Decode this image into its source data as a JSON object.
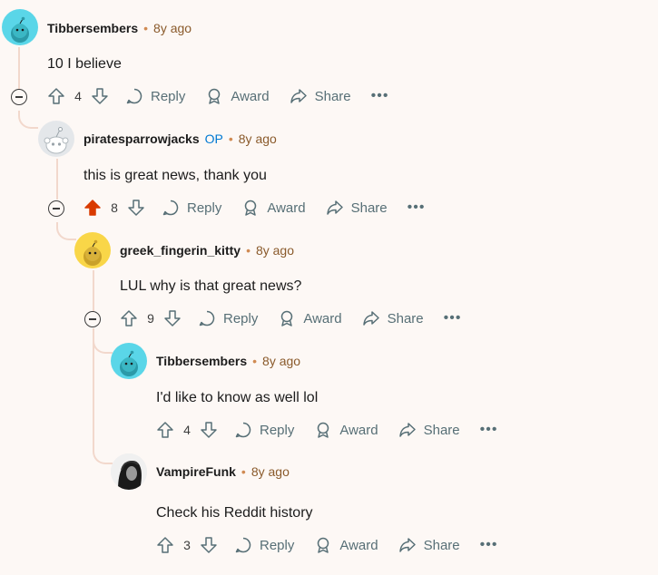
{
  "comments": [
    {
      "username": "Tibbersembers",
      "op": "",
      "time": "8y ago",
      "body": "10 I believe",
      "votes": "4",
      "upvoted": false,
      "avatar": "snoo-teal"
    },
    {
      "username": "piratesparrowjacks",
      "op": "OP",
      "time": "8y ago",
      "body": "this is great news, thank you",
      "votes": "8",
      "upvoted": true,
      "avatar": "snoo-grey"
    },
    {
      "username": "greek_fingerin_kitty",
      "op": "",
      "time": "8y ago",
      "body": "LUL why is that great news?",
      "votes": "9",
      "upvoted": false,
      "avatar": "snoo-yellow"
    },
    {
      "username": "Tibbersembers",
      "op": "",
      "time": "8y ago",
      "body": "I'd like to know as well lol",
      "votes": "4",
      "upvoted": false,
      "avatar": "snoo-teal"
    },
    {
      "username": "VampireFunk",
      "op": "",
      "time": "8y ago",
      "body": "Check his Reddit history",
      "votes": "3",
      "upvoted": false,
      "avatar": "photo"
    }
  ],
  "labels": {
    "reply": "Reply",
    "award": "Award",
    "share": "Share",
    "more": "•••",
    "separator": "•"
  },
  "colors": {
    "upvote_active": "#d93a00",
    "thread_line": "#f2d8cc",
    "op": "#0079d3"
  }
}
